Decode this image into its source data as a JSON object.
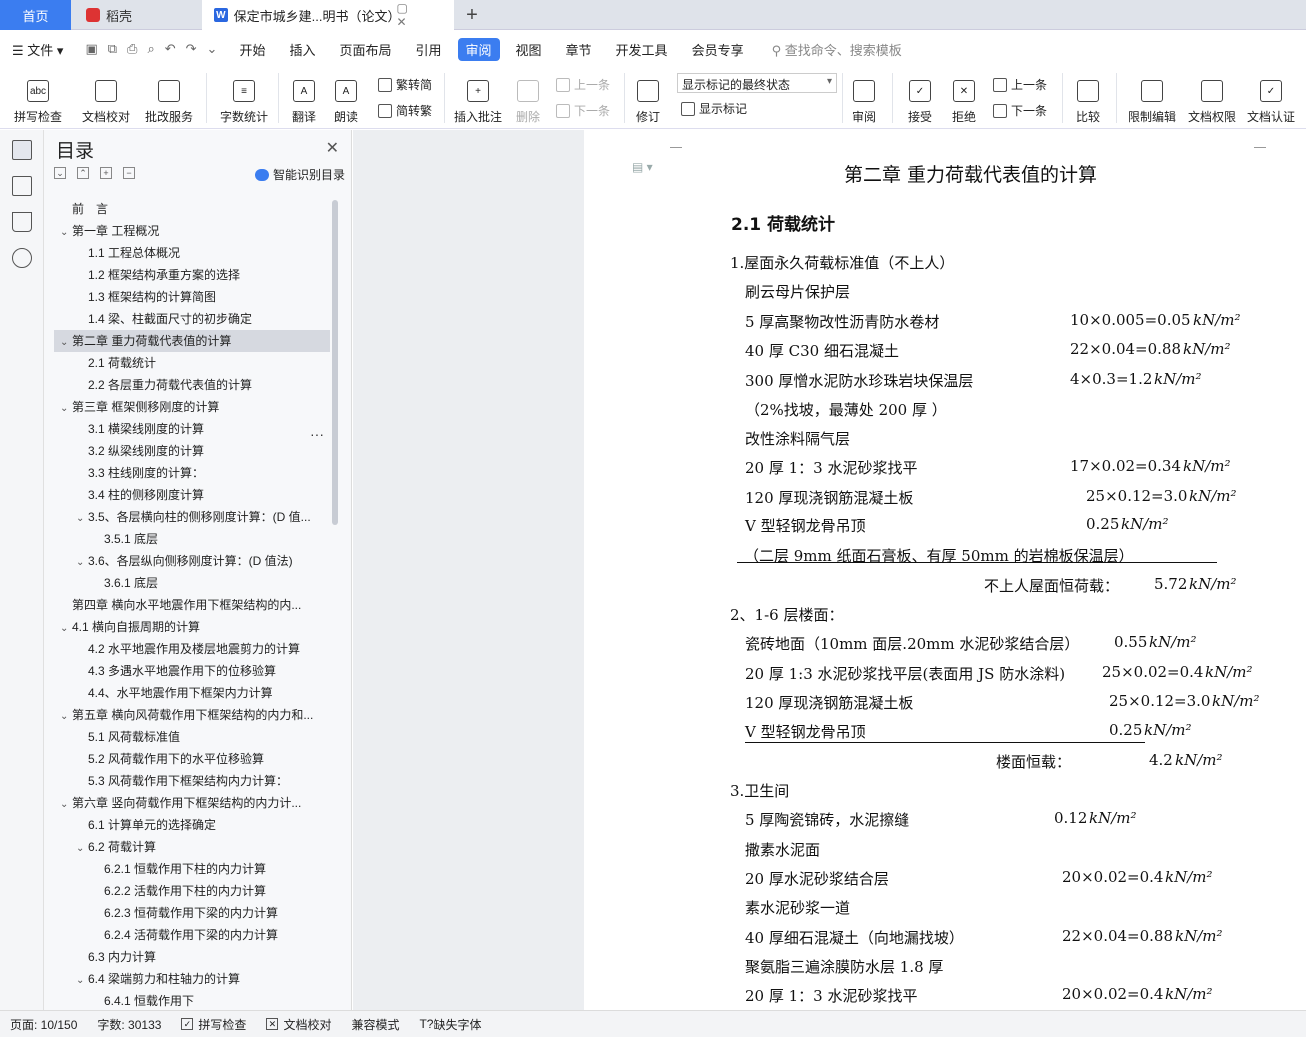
{
  "tabs": {
    "home": "首页",
    "daoke": "稻壳",
    "doc": "保定市城乡建...明书（论文）",
    "add": "+"
  },
  "menu": {
    "file": "文件",
    "items": [
      "开始",
      "插入",
      "页面布局",
      "引用",
      "审阅",
      "视图",
      "章节",
      "开发工具",
      "会员专享"
    ],
    "active": "审阅",
    "search": "查找命令、搜索模板"
  },
  "toolbar": {
    "spell": "拼写检查",
    "doc_check": "文档校对",
    "annot_service": "批改服务",
    "word_count": "字数统计",
    "translate": "翻译",
    "read": "朗读",
    "trad_to_simp": "繁转简",
    "simp_to_trad": "简转繁",
    "insert_comment": "插入批注",
    "delete": "删除",
    "prev": "上一条",
    "next": "下一条",
    "revise": "修订",
    "markup_mode": "显示标记的最终状态",
    "show_markup": "显示标记",
    "review": "审阅",
    "accept": "接受",
    "reject": "拒绝",
    "prev2": "上一条",
    "next2": "下一条",
    "compare": "比较",
    "restrict": "限制编辑",
    "permission": "文档权限",
    "certify": "文档认证"
  },
  "nav": {
    "title": "目录",
    "smart": "智能识别目录",
    "items": [
      {
        "text": "前　言",
        "level": 1,
        "arrow": ""
      },
      {
        "text": "第一章 工程概况",
        "level": 1,
        "arrow": "v"
      },
      {
        "text": "1.1 工程总体概况",
        "level": 2,
        "arrow": ""
      },
      {
        "text": "1.2 框架结构承重方案的选择",
        "level": 2,
        "arrow": ""
      },
      {
        "text": "1.3  框架结构的计算简图",
        "level": 2,
        "arrow": ""
      },
      {
        "text": "1.4  梁、柱截面尺寸的初步确定",
        "level": 2,
        "arrow": ""
      },
      {
        "text": "第二章  重力荷载代表值的计算",
        "level": 1,
        "arrow": "v",
        "selected": true
      },
      {
        "text": "2.1 荷载统计",
        "level": 2,
        "arrow": ""
      },
      {
        "text": "2.2 各层重力荷载代表值的计算",
        "level": 2,
        "arrow": ""
      },
      {
        "text": "第三章    框架侧移刚度的计算",
        "level": 1,
        "arrow": "v"
      },
      {
        "text": "3.1 横梁线刚度的计算",
        "level": 2,
        "arrow": ""
      },
      {
        "text": "3.2 纵梁线刚度的计算",
        "level": 2,
        "arrow": ""
      },
      {
        "text": "3.3 柱线刚度的计算：",
        "level": 2,
        "arrow": ""
      },
      {
        "text": "3.4 柱的侧移刚度计算",
        "level": 2,
        "arrow": ""
      },
      {
        "text": "3.5、各层横向柱的侧移刚度计算：(D 值...",
        "level": 2,
        "arrow": "v"
      },
      {
        "text": "3.5.1 底层",
        "level": 3,
        "arrow": ""
      },
      {
        "text": "3.6、各层纵向侧移刚度计算：(D 值法)",
        "level": 2,
        "arrow": "v"
      },
      {
        "text": "3.6.1 底层",
        "level": 3,
        "arrow": ""
      },
      {
        "text": "第四章    横向水平地震作用下框架结构的内...",
        "level": 1,
        "arrow": ""
      },
      {
        "text": "4.1 横向自振周期的计算",
        "level": 1,
        "arrow": "v"
      },
      {
        "text": "4.2 水平地震作用及楼层地震剪力的计算",
        "level": 2,
        "arrow": ""
      },
      {
        "text": "4.3 多遇水平地震作用下的位移验算",
        "level": 2,
        "arrow": ""
      },
      {
        "text": "4.4、水平地震作用下框架内力计算",
        "level": 2,
        "arrow": ""
      },
      {
        "text": "第五章  横向风荷载作用下框架结构的内力和...",
        "level": 1,
        "arrow": "v"
      },
      {
        "text": "5.1 风荷载标准值",
        "level": 2,
        "arrow": ""
      },
      {
        "text": "5.2 风荷载作用下的水平位移验算",
        "level": 2,
        "arrow": ""
      },
      {
        "text": "5.3 风荷载作用下框架结构内力计算：",
        "level": 2,
        "arrow": ""
      },
      {
        "text": "第六章    竖向荷载作用下框架结构的内力计...",
        "level": 1,
        "arrow": "v"
      },
      {
        "text": "6.1 计算单元的选择确定",
        "level": 2,
        "arrow": ""
      },
      {
        "text": "6.2 荷载计算",
        "level": 2,
        "arrow": "v"
      },
      {
        "text": "6.2.1 恒载作用下柱的内力计算",
        "level": 3,
        "arrow": ""
      },
      {
        "text": "6.2.2 活载作用下柱的内力计算",
        "level": 3,
        "arrow": ""
      },
      {
        "text": "6.2.3 恒荷载作用下梁的内力计算",
        "level": 3,
        "arrow": ""
      },
      {
        "text": "6.2.4 活荷载作用下梁的内力计算",
        "level": 3,
        "arrow": ""
      },
      {
        "text": "6.3 内力计算",
        "level": 2,
        "arrow": ""
      },
      {
        "text": "6.4 梁端剪力和柱轴力的计算",
        "level": 2,
        "arrow": "v"
      },
      {
        "text": "6.4.1 恒载作用下",
        "level": 3,
        "arrow": ""
      }
    ]
  },
  "doc": {
    "chapter": "第二章  重力荷载代表值的计算",
    "section": "2.1 荷载统计",
    "unit": "kN/m²",
    "lines": [
      {
        "text": "1.屋面永久荷载标准值（不上人）",
        "val": ""
      },
      {
        "text": "刷云母片保护层",
        "val": ""
      },
      {
        "text": "5 厚高聚物改性沥青防水卷材",
        "val": "10×0.005=0.05"
      },
      {
        "text": "40 厚 C30 细石混凝土",
        "val": "22×0.04=0.88"
      },
      {
        "text": "300 厚憎水泥防水珍珠岩块保温层",
        "val": "4×0.3=1.2"
      },
      {
        "text": "（2%找坡，最薄处 200 厚  ）",
        "val": ""
      },
      {
        "text": "改性涂料隔气层",
        "val": ""
      },
      {
        "text": "20 厚 1：3 水泥砂浆找平",
        "val": "17×0.02=0.34"
      },
      {
        "text": "120 厚现浇钢筋混凝土板",
        "val": "25×0.12=3.0"
      },
      {
        "text": "V 型轻钢龙骨吊顶",
        "val": "0.25"
      },
      {
        "text": "（二层 9mm 纸面石膏板、有厚 50mm 的岩棉板保温层）",
        "val": ""
      },
      {
        "text": "不上人屋面恒荷载：",
        "val": "5.72"
      },
      {
        "text": "2、1-6 层楼面：",
        "val": ""
      },
      {
        "text": "瓷砖地面（10mm 面层.20mm 水泥砂浆结合层）",
        "val": "0.55"
      },
      {
        "text": "20 厚 1:3 水泥砂浆找平层(表面用 JS 防水涂料)",
        "val": "25×0.02=0.4"
      },
      {
        "text": "120 厚现浇钢筋混凝土板",
        "val": "25×0.12=3.0"
      },
      {
        "text": "V 型轻钢龙骨吊顶",
        "val": "0.25"
      },
      {
        "text": "楼面恒载：",
        "val": "4.2"
      },
      {
        "text": "3.卫生间",
        "val": ""
      },
      {
        "text": "5 厚陶瓷锦砖，水泥擦缝",
        "val": "0.12"
      },
      {
        "text": "撒素水泥面",
        "val": ""
      },
      {
        "text": "20 厚水泥砂浆结合层",
        "val": "20×0.02=0.4"
      },
      {
        "text": "素水泥砂浆一道",
        "val": ""
      },
      {
        "text": "40 厚细石混凝土（向地漏找坡）",
        "val": "22×0.04=0.88"
      },
      {
        "text": "聚氨脂三遍涂膜防水层 1.8 厚",
        "val": ""
      },
      {
        "text": "20 厚 1：3 水泥砂浆找平",
        "val": "20×0.02=0.4"
      }
    ]
  },
  "status": {
    "page": "页面: 10/150",
    "words": "字数: 30133",
    "spell": "拼写检查",
    "check": "文档校对",
    "compat": "兼容模式",
    "font": "缺失字体"
  }
}
